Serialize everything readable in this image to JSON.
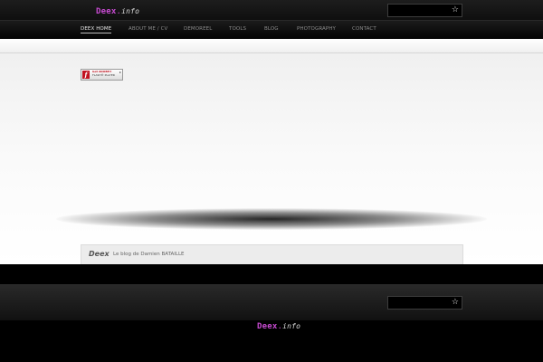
{
  "header": {
    "logo": {
      "brand": "Deex",
      "dot": ".",
      "tld": "info"
    },
    "search": {
      "placeholder": "",
      "icon": "star-icon",
      "glyph": "☆"
    }
  },
  "nav": {
    "items": [
      {
        "label": "DEEX HOME",
        "active": true
      },
      {
        "label": "ABOUT ME / CV",
        "active": false
      },
      {
        "label": "DEMOREEL",
        "active": false
      },
      {
        "label": "TOOLS",
        "active": false
      },
      {
        "label": "BLOG",
        "active": false
      },
      {
        "label": "PHOTOGRAPHY",
        "active": false
      },
      {
        "label": "CONTACT",
        "active": false
      }
    ]
  },
  "flash_badge": {
    "line1": "Get ADOBE®",
    "line2": "FLASH® PLAYER",
    "chevron": "▸"
  },
  "footer_card": {
    "title": "Deex",
    "subtitle": "Le blog de Damien BATAILLE"
  },
  "bottom": {
    "search": {
      "placeholder": "",
      "glyph": "☆"
    },
    "logo": {
      "brand": "Deex",
      "dot": ".",
      "tld": "info"
    }
  },
  "colors": {
    "accent": "#c64ad0",
    "background": "#000000",
    "content": "#f5f5f5"
  }
}
